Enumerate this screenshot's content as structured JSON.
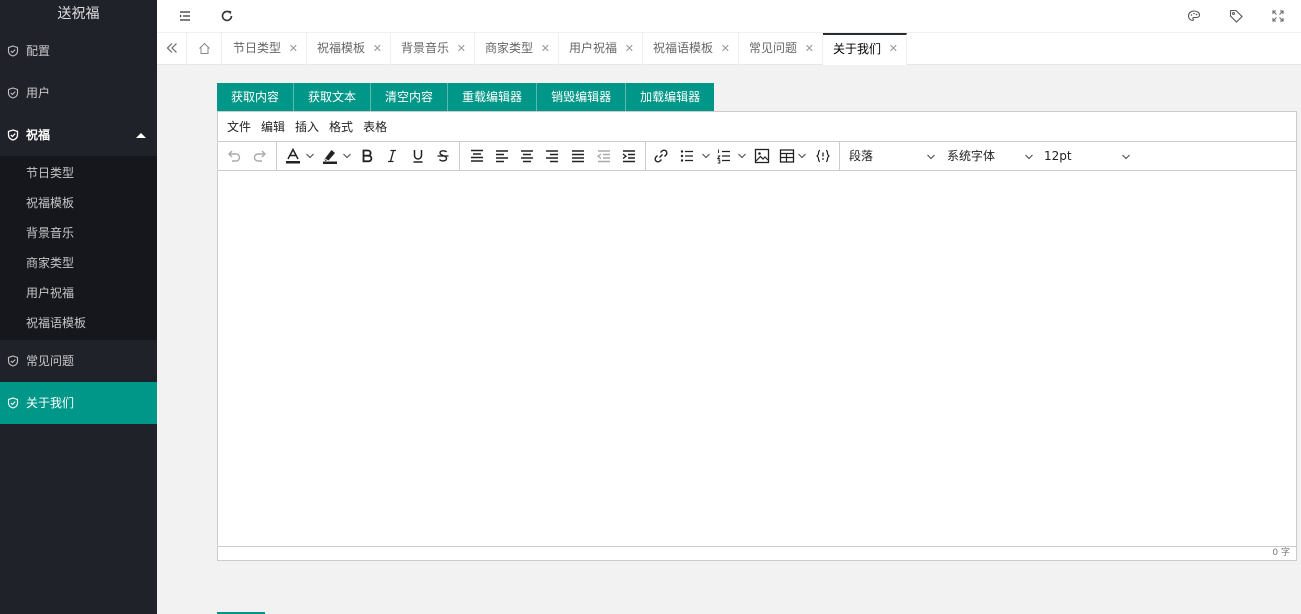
{
  "sidebar": {
    "logo": "送祝福",
    "items": [
      {
        "label": "配置"
      },
      {
        "label": "用户"
      },
      {
        "label": "祝福"
      },
      {
        "label": "常见问题"
      },
      {
        "label": "关于我们"
      }
    ],
    "subitems": [
      {
        "label": "节日类型"
      },
      {
        "label": "祝福模板"
      },
      {
        "label": "背景音乐"
      },
      {
        "label": "商家类型"
      },
      {
        "label": "用户祝福"
      },
      {
        "label": "祝福语模板"
      }
    ],
    "accent": "#009688"
  },
  "tabs": [
    {
      "label": "节日类型"
    },
    {
      "label": "祝福模板"
    },
    {
      "label": "背景音乐"
    },
    {
      "label": "商家类型"
    },
    {
      "label": "用户祝福"
    },
    {
      "label": "祝福语模板"
    },
    {
      "label": "常见问题"
    },
    {
      "label": "关于我们"
    }
  ],
  "tab_close": "✕",
  "buttons": [
    {
      "label": "获取内容"
    },
    {
      "label": "获取文本"
    },
    {
      "label": "清空内容"
    },
    {
      "label": "重载编辑器"
    },
    {
      "label": "销毁编辑器"
    },
    {
      "label": "加载编辑器"
    }
  ],
  "editor": {
    "menus": [
      {
        "label": "文件"
      },
      {
        "label": "编辑"
      },
      {
        "label": "插入"
      },
      {
        "label": "格式"
      },
      {
        "label": "表格"
      }
    ],
    "block_format": "段落",
    "font_family": "系统字体",
    "font_size": "12pt",
    "word_count": "0 字"
  }
}
